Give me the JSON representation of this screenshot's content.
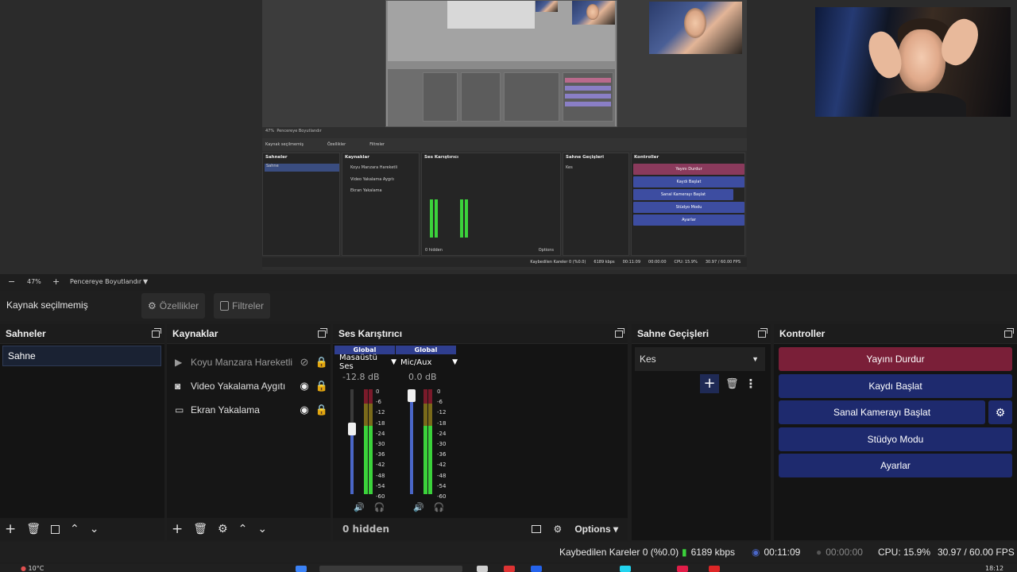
{
  "preview": {
    "inner": {
      "context_label": "Kaynak seçilmemiş",
      "properties": "Özellikler",
      "filters": "Filtreler",
      "scenes_title": "Sahneler",
      "scene": "Sahne",
      "sources_title": "Kaynaklar",
      "sources": [
        "Koyu Manzara Hareketli",
        "Video Yakalama Aygıtı",
        "Ekran Yakalama"
      ],
      "mixer_title": "Ses Karıştırıcı",
      "transitions_title": "Sahne Geçişleri",
      "transition": "Kes",
      "controls_title": "Kontroller",
      "controls": [
        "Yayını Durdur",
        "Kaydı Başlat",
        "Sanal Kamerayı Başlat",
        "Stüdyo Modu",
        "Ayarlar"
      ],
      "hidden": "0 hidden",
      "options": "Options",
      "status": [
        "Kaybedilen Kareler 0 (%0.0)",
        "6189 kbps",
        "00:11:09",
        "00:00:00",
        "CPU: 15.9%",
        "30.97 / 60.00 FPS"
      ],
      "zoom": "47%",
      "fit": "Pencereye Boyutlandır"
    }
  },
  "zoom_bar": {
    "minus": "−",
    "zoom": "47%",
    "plus": "+",
    "fit_label": "Pencereye Boyutlandır"
  },
  "context": {
    "label": "Kaynak seçilmemiş",
    "properties": "Özellikler",
    "filters": "Filtreler"
  },
  "scenes": {
    "title": "Sahneler",
    "items": [
      "Sahne"
    ]
  },
  "sources": {
    "title": "Kaynaklar",
    "items": [
      {
        "name": "Koyu Manzara Hareketli",
        "icon": "play-icon",
        "visible": false
      },
      {
        "name": "Video Yakalama Aygıtı",
        "icon": "camera-icon",
        "visible": true
      },
      {
        "name": "Ekran Yakalama",
        "icon": "monitor-icon",
        "visible": true
      }
    ]
  },
  "mixer": {
    "title": "Ses Karıştırıcı",
    "channels": [
      {
        "badge": "Global",
        "name": "Masaüstü Ses",
        "db": "-12.8 dB",
        "fader": 0.62
      },
      {
        "badge": "Global",
        "name": "Mic/Aux",
        "db": "0.0 dB",
        "fader": 1.0
      }
    ],
    "ticks": [
      "0",
      "-6",
      "-12",
      "-18",
      "-24",
      "-30",
      "-36",
      "-42",
      "-48",
      "-54",
      "-60"
    ],
    "hidden": "0 hidden",
    "options": "Options"
  },
  "transitions": {
    "title": "Sahne Geçişleri",
    "selected": "Kes"
  },
  "controls": {
    "title": "Kontroller",
    "stop_stream": "Yayını Durdur",
    "start_record": "Kaydı Başlat",
    "start_virtualcam": "Sanal Kamerayı Başlat",
    "studio_mode": "Stüdyo Modu",
    "settings": "Ayarlar"
  },
  "status": {
    "dropped": "Kaybedilen Kareler 0 (%0.0)",
    "bitrate": "6189 kbps",
    "stream_time": "00:11:09",
    "record_time": "00:00:00",
    "cpu": "CPU: 15.9%",
    "fps": "30.97 / 60.00 FPS"
  },
  "taskbar": {
    "weather": "10°C",
    "clock": "18:12"
  },
  "colors": {
    "stop_stream": "#7a1f38",
    "control_button": "#1e2a6e",
    "accent": "#4a66c8",
    "meter_green": "#3bd23b"
  }
}
